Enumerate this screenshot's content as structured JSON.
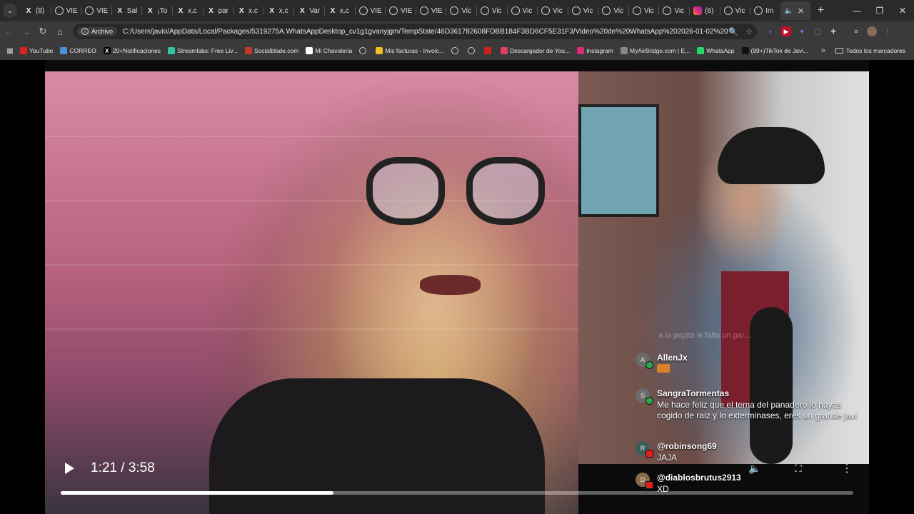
{
  "tabs": [
    {
      "icon": "x-logo-icon",
      "label": "(8)"
    },
    {
      "icon": "globe-icon",
      "label": "VIE"
    },
    {
      "icon": "globe-icon",
      "label": "VIE"
    },
    {
      "icon": "x-logo-icon",
      "label": "Sal"
    },
    {
      "icon": "x-logo-icon",
      "label": "¡To"
    },
    {
      "icon": "x-logo-icon",
      "label": "x.c"
    },
    {
      "icon": "x-logo-icon",
      "label": "par"
    },
    {
      "icon": "x-logo-icon",
      "label": "x.c"
    },
    {
      "icon": "x-logo-icon",
      "label": "x.c"
    },
    {
      "icon": "x-logo-icon",
      "label": "Var"
    },
    {
      "icon": "x-logo-icon",
      "label": "x.c"
    },
    {
      "icon": "globe-icon",
      "label": "VIE"
    },
    {
      "icon": "globe-icon",
      "label": "VIE"
    },
    {
      "icon": "globe-icon",
      "label": "VIE"
    },
    {
      "icon": "globe-icon",
      "label": "Vic"
    },
    {
      "icon": "globe-icon",
      "label": "Vic"
    },
    {
      "icon": "globe-icon",
      "label": "Vic"
    },
    {
      "icon": "globe-icon",
      "label": "Vic"
    },
    {
      "icon": "globe-icon",
      "label": "Vic"
    },
    {
      "icon": "globe-icon",
      "label": "Vic"
    },
    {
      "icon": "globe-icon",
      "label": "Vic"
    },
    {
      "icon": "globe-icon",
      "label": "Vic"
    },
    {
      "icon": "instagram-icon",
      "label": "(6)"
    },
    {
      "icon": "globe-icon",
      "label": "Vic"
    },
    {
      "icon": "globe-icon",
      "label": "Im"
    }
  ],
  "active_tab": {
    "icon": "speaker-icon",
    "close": "✕"
  },
  "window_controls": {
    "minimize": "—",
    "restore": "❐",
    "close": "✕"
  },
  "address": {
    "chip_label": "Archivo",
    "url": "C:/Users/javio/AppData/Local/Packages/5319275A.WhatsAppDesktop_cv1g1gvanyjgm/TempState/46D361782608FDBB184F3BD6CF5E31F3/Video%20de%20WhatsApp%202026-01-02%20a%20las%2018.40..."
  },
  "bookmarks": [
    {
      "label": "YouTube",
      "icon": "youtube-icon",
      "color": "#e02020"
    },
    {
      "label": "CORREO",
      "icon": "mail-icon",
      "color": "#4a90d9"
    },
    {
      "label": "20+Notificaciones",
      "icon": "x-logo-icon",
      "color": "#000000"
    },
    {
      "label": "Streamlabs: Free Liv...",
      "icon": "streamlabs-icon",
      "color": "#31c3a2"
    },
    {
      "label": "Socialblade.com",
      "icon": "chart-icon",
      "color": "#c0392b"
    },
    {
      "label": "Mi Chavaleria",
      "icon": "clock-icon",
      "color": "#ffffff"
    },
    {
      "label": "",
      "icon": "globe-icon",
      "color": "#888888"
    },
    {
      "label": "Mis facturas - Invoic...",
      "icon": "invoice-icon",
      "color": "#f0c020"
    },
    {
      "label": "",
      "icon": "globe-icon",
      "color": "#888888"
    },
    {
      "label": "",
      "icon": "globe-icon",
      "color": "#888888"
    },
    {
      "label": "",
      "icon": "apple-icon",
      "color": "#d02020"
    },
    {
      "label": "Descargador de You...",
      "icon": "download-icon",
      "color": "#e04060"
    },
    {
      "label": "Instagram",
      "icon": "instagram-icon",
      "color": "#dd2a7b"
    },
    {
      "label": "MyAirBridge.com | E...",
      "icon": "cloud-icon",
      "color": "#888888"
    },
    {
      "label": "WhatsApp",
      "icon": "whatsapp-icon",
      "color": "#25d366"
    },
    {
      "label": "(99+)TikTok de Javi...",
      "icon": "tiktok-icon",
      "color": "#111111"
    }
  ],
  "bookmarks_more": "»",
  "bookmarks_folder": "Todos los marcadores",
  "chat": {
    "faded_line": "a la pepita le falta un par...",
    "messages": [
      {
        "user": "AllenJx",
        "text": "",
        "initial": "A",
        "platform": "kick"
      },
      {
        "user": "SangraTormentas",
        "text": "Me hace feliz que el tema del panadero lo hayas cogido de raiz y lo exterminases, eres un grande javi",
        "initial": "S",
        "platform": "kick"
      },
      {
        "user": "@robinsong69",
        "text": "JAJA",
        "initial": "R",
        "platform": "youtube"
      },
      {
        "user": "@diablosbrutus2913",
        "text": "XD",
        "initial": "D",
        "platform": "youtube"
      }
    ]
  },
  "player": {
    "time": "1:21 / 3:58",
    "progress": 0.344,
    "volume_icon": "🔈",
    "fullscreen_icon": "⛶",
    "more_icon": "⋮"
  }
}
